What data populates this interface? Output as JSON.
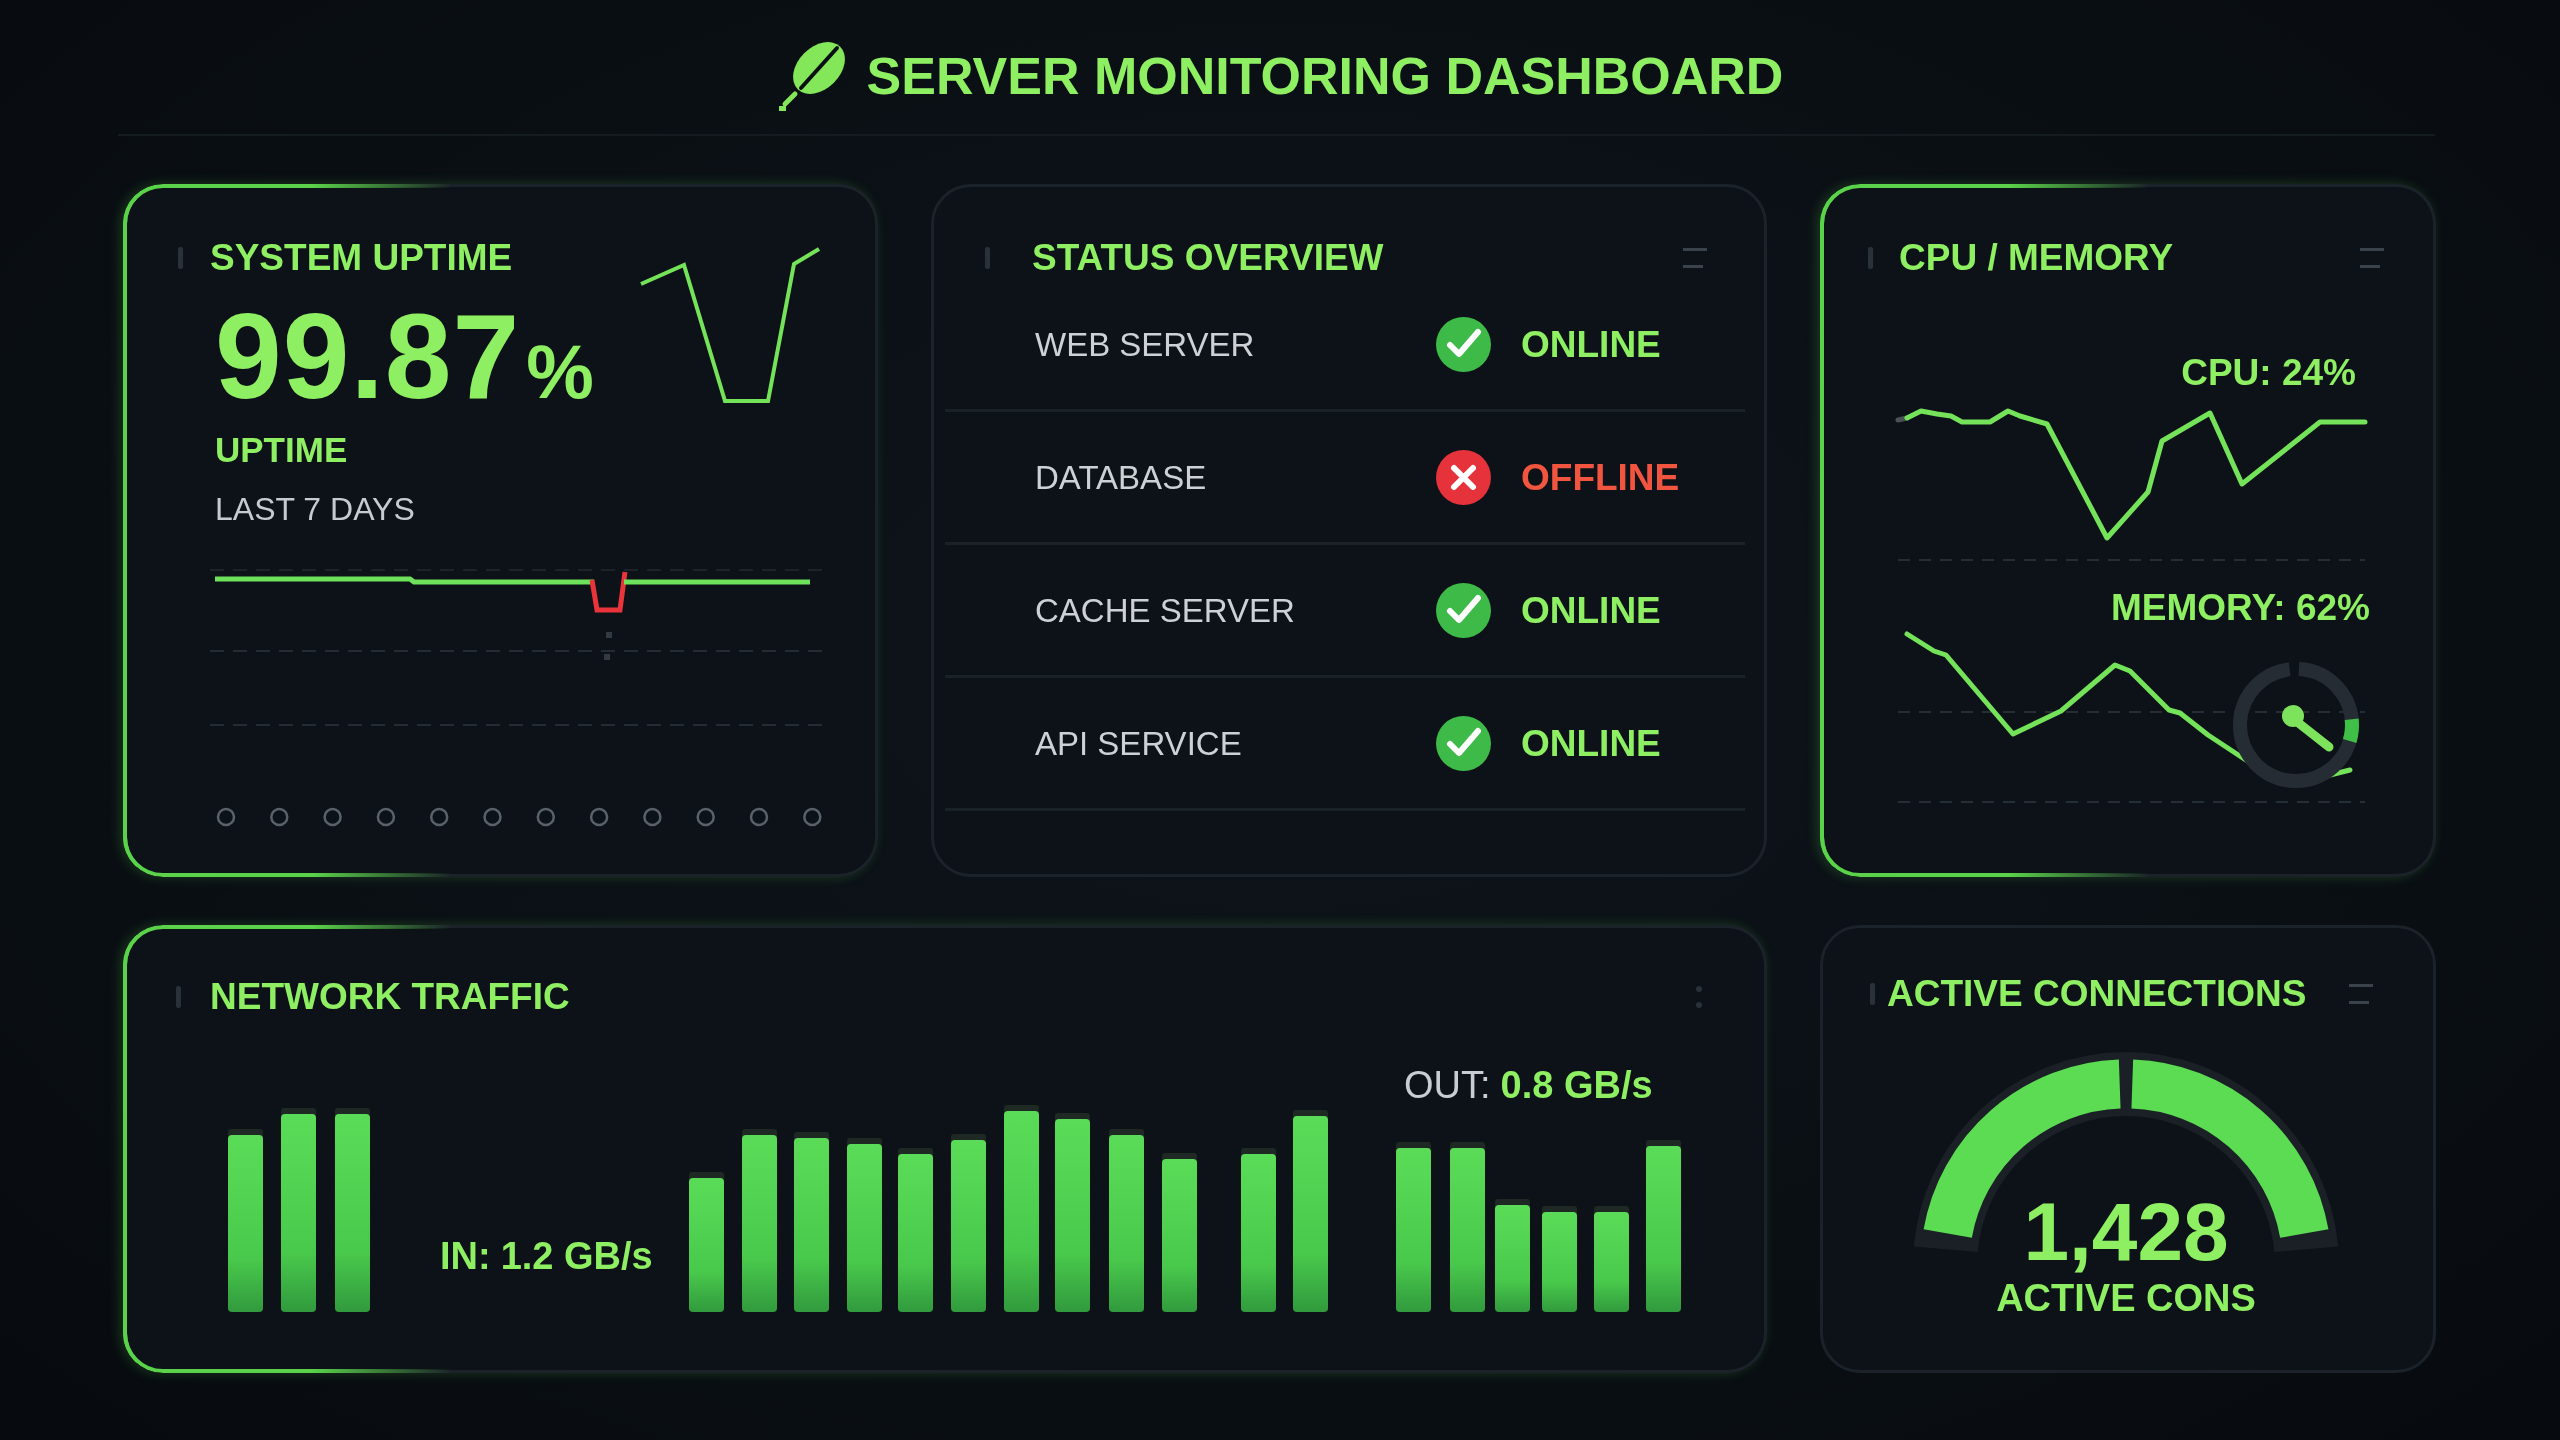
{
  "header": {
    "title": "SERVER MONITORING DASHBOARD"
  },
  "panels": [
    {
      "kind": "uptime",
      "title": "SYSTEM UPTIME",
      "highlighted": true,
      "value": "99.87",
      "unit": "%",
      "label": "UPTIME",
      "period": "LAST 7 DAYS"
    },
    {
      "kind": "status",
      "title": "STATUS OVERVIEW",
      "highlighted": false,
      "services": [
        {
          "name": "WEB SERVER",
          "status": "ONLINE",
          "online": true
        },
        {
          "name": "DATABASE",
          "status": "OFFLINE",
          "online": false
        },
        {
          "name": "CACHE SERVER",
          "status": "ONLINE",
          "online": true
        },
        {
          "name": "API SERVICE",
          "status": "ONLINE",
          "online": true
        }
      ]
    },
    {
      "kind": "resources",
      "title": "CPU / MEMORY",
      "highlighted": true,
      "metrics": [
        {
          "kind": "cpu",
          "reading": "CPU: 24%"
        },
        {
          "kind": "memory",
          "reading": "MEMORY: 62%"
        }
      ]
    },
    {
      "kind": "network",
      "title": "NETWORK TRAFFIC",
      "highlighted": true,
      "inbound": {
        "label": "IN:",
        "value": "1.2 GB/s"
      },
      "outbound": {
        "label": "OUT:",
        "value": "0.8 GB/s"
      }
    },
    {
      "kind": "connections",
      "title": "ACTIVE CONNECTIONS",
      "highlighted": false,
      "count": "1,428",
      "caption": "ACTIVE CONS",
      "level": 1
    }
  ]
}
